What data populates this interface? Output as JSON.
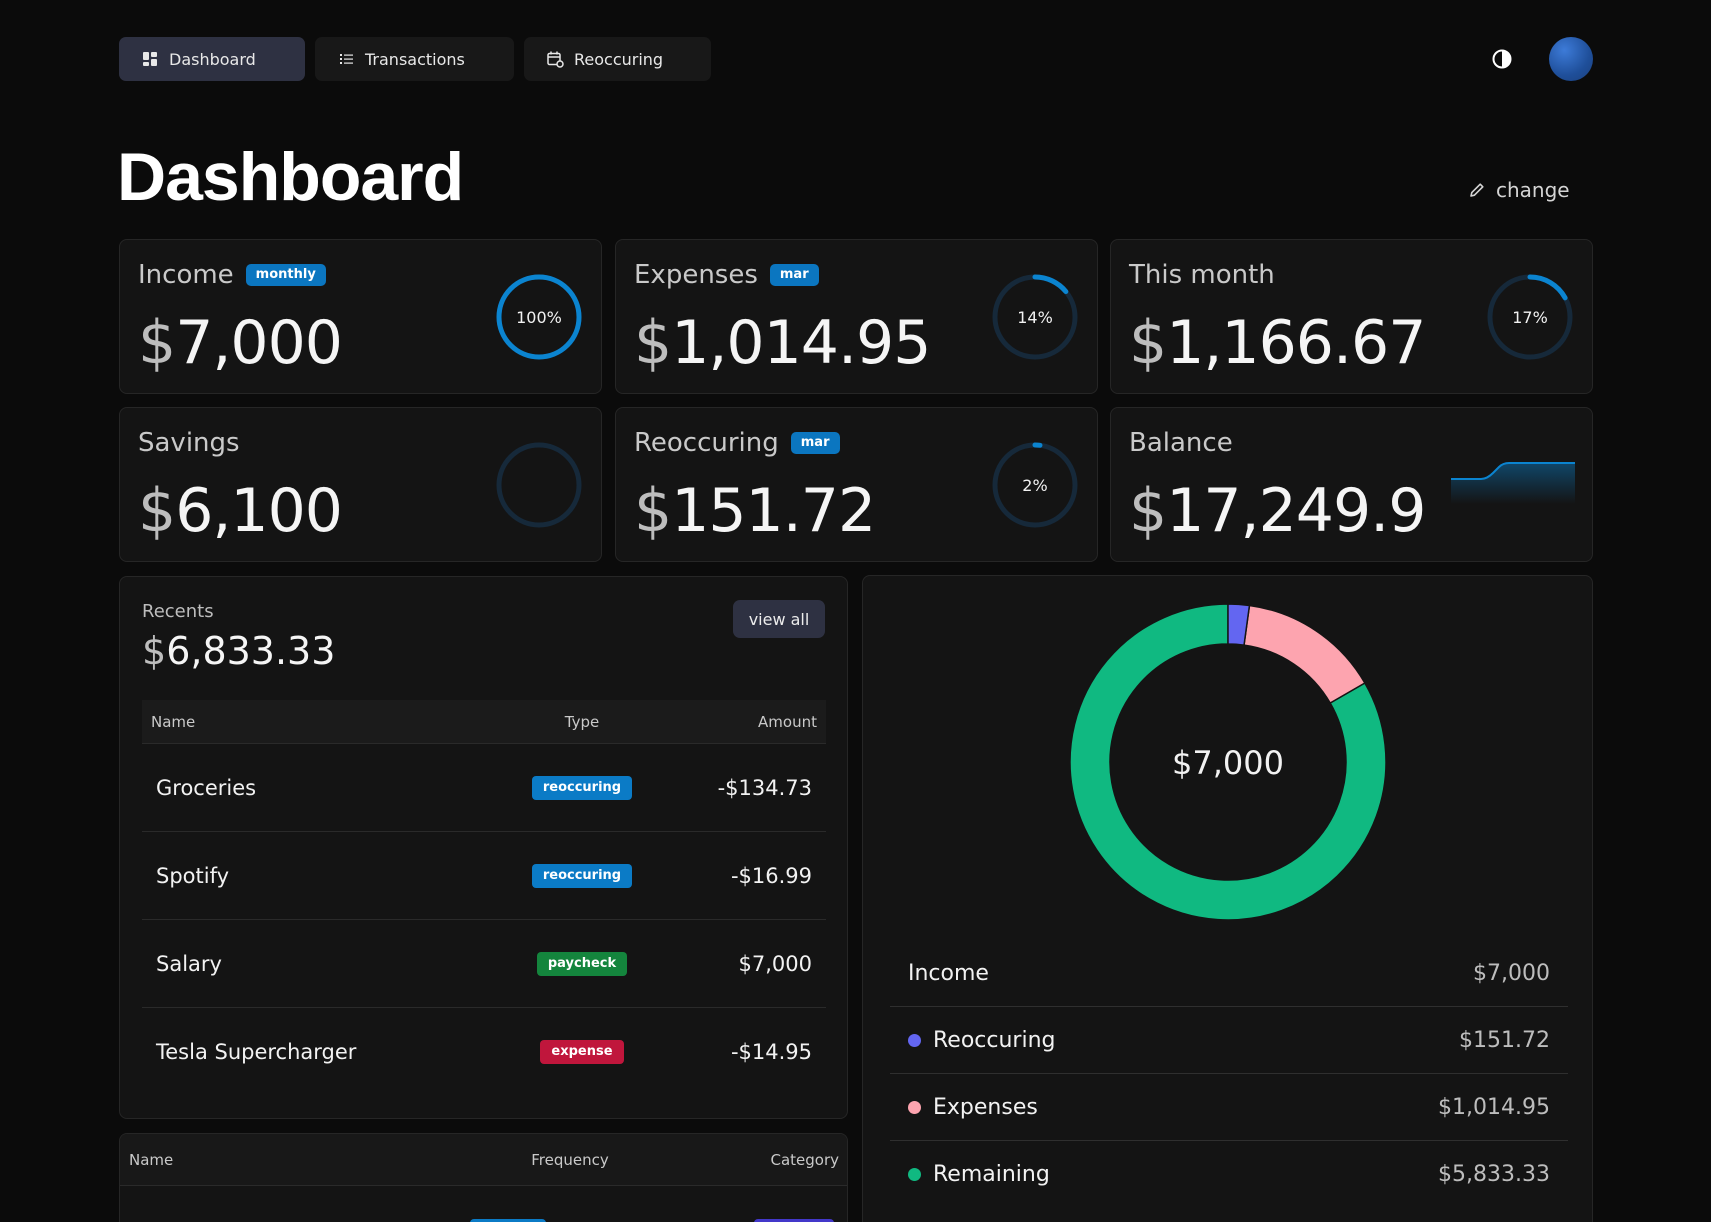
{
  "nav": {
    "items": [
      {
        "label": "Dashboard",
        "icon": "dashboard-icon",
        "active": true
      },
      {
        "label": "Transactions",
        "icon": "list-icon",
        "active": false
      },
      {
        "label": "Reoccuring",
        "icon": "calendar-repeat-icon",
        "active": false
      }
    ],
    "theme_icon": "contrast-icon"
  },
  "page": {
    "title": "Dashboard",
    "change_label": "change"
  },
  "stats": {
    "income": {
      "label": "Income",
      "badge": "monthly",
      "currency": "$",
      "value": "7,000",
      "percent_label": "100%",
      "percent": 100
    },
    "expenses": {
      "label": "Expenses",
      "badge": "mar",
      "currency": "$",
      "value": "1,014.95",
      "percent_label": "14%",
      "percent": 14
    },
    "this_month": {
      "label": "This month",
      "currency": "$",
      "value": "1,166.67",
      "percent_label": "17%",
      "percent": 17
    },
    "savings": {
      "label": "Savings",
      "currency": "$",
      "value": "6,100",
      "percent": 0
    },
    "reoccuring": {
      "label": "Reoccuring",
      "badge": "mar",
      "currency": "$",
      "value": "151.72",
      "percent_label": "2%",
      "percent": 2
    },
    "balance": {
      "label": "Balance",
      "currency": "$",
      "value": "17,249.9"
    }
  },
  "recents": {
    "label": "Recents",
    "currency": "$",
    "total": "6,833.33",
    "view_all_label": "view all",
    "columns": {
      "name": "Name",
      "type": "Type",
      "amount": "Amount"
    },
    "rows": [
      {
        "name": "Groceries",
        "type": "reoccuring",
        "amount": "-$134.73"
      },
      {
        "name": "Spotify",
        "type": "reoccuring",
        "amount": "-$16.99"
      },
      {
        "name": "Salary",
        "type": "paycheck",
        "amount": "$7,000"
      },
      {
        "name": "Tesla Supercharger",
        "type": "expense",
        "amount": "-$14.95"
      }
    ]
  },
  "tag_colors": {
    "reoccuring": "#0b7bc6",
    "paycheck": "#14853d",
    "expense": "#c0163c"
  },
  "reoccuring_table": {
    "columns": {
      "name": "Name",
      "frequency": "Frequency",
      "category": "Category"
    }
  },
  "breakdown": {
    "center_label": "$7,000",
    "legend": [
      {
        "name": "Income",
        "value": "$7,000",
        "color": ""
      },
      {
        "name": "Reoccuring",
        "value": "$151.72",
        "color": "#6366f1"
      },
      {
        "name": "Expenses",
        "value": "$1,014.95",
        "color": "#fda4af"
      },
      {
        "name": "Remaining",
        "value": "$5,833.33",
        "color": "#10b981"
      }
    ]
  },
  "chart_data": {
    "type": "pie",
    "categories": [
      "Reoccuring",
      "Expenses",
      "Remaining"
    ],
    "values": [
      151.72,
      1014.95,
      5833.33
    ],
    "colors": [
      "#6366f1",
      "#fda4af",
      "#10b981"
    ],
    "center_label": "$7,000"
  },
  "colors": {
    "accent": "#0b84d0",
    "ring_track": "#16293a",
    "card_bg": "#141414"
  }
}
